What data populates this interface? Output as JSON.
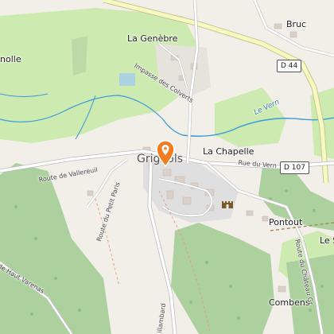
{
  "map": {
    "marker": {
      "icon": "map-pin-icon",
      "color": "#f47c20"
    },
    "poi": {
      "icon": "castle-icon"
    },
    "places": {
      "bruc": "Bruc",
      "genebre": "La Genèbre",
      "nolle": "nolle",
      "chapelle": "La Chapelle",
      "grignols": "Grignols",
      "pontout": "Pontout",
      "le_s": "Le S",
      "combens": "Combens"
    },
    "roads": {
      "d44": "D 44",
      "d107": "D 107",
      "route_vallereuil": "Route de Vallereuil",
      "rue_vern": "Rue du Vern",
      "impasse_colverts": "Impasse des Colverts",
      "route_petit_paris": "Route du Petit Paris",
      "route_chateau": "Route du Château Gr",
      "haut_varenas": "de Haut Varenas",
      "illambard": "illambard"
    },
    "waterways": {
      "le_vern": "Le Vern"
    },
    "colors": {
      "background": "#f2efe9",
      "forest": "#add19e",
      "meadow": "#cdebb0",
      "water": "#aad3df",
      "stream": "#3b9ad9",
      "road_primary": "#f7fabf",
      "road_secondary": "#ffffff",
      "building": "#d9d0c9"
    }
  }
}
